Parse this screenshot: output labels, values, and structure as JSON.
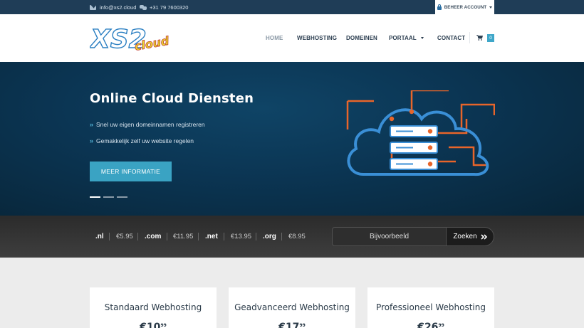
{
  "topbar": {
    "email": "info@xs2.cloud",
    "phone": "+31 79 7600320",
    "account_label": "BEHEER ACCOUNT"
  },
  "header": {
    "logo_text_main": "XS2",
    "logo_text_sub": "cloud",
    "nav": {
      "home": "HOME",
      "webhosting": "WEBHOSTING",
      "domeinen": "DOMEINEN",
      "portaal": "PORTAAL",
      "contact": "CONTACT"
    },
    "cart_count": "0"
  },
  "hero": {
    "title": "Online Cloud Diensten",
    "bullets": [
      "Snel uw eigen domeinnamen registreren",
      "Gemakkelijk zelf uw website regelen"
    ],
    "button_label": "MEER INFORMATIE",
    "slides_total": 3,
    "active_slide": 1
  },
  "domains": {
    "tlds": [
      {
        "name": ".nl",
        "price": "€5.95"
      },
      {
        "name": ".com",
        "price": "€11.95"
      },
      {
        "name": ".net",
        "price": "€13.95"
      },
      {
        "name": ".org",
        "price": "€8.95"
      }
    ],
    "search_placeholder": "Bijvoorbeeld",
    "search_button": "Zoeken"
  },
  "plans": [
    {
      "title": "Standaard Webhosting",
      "price_main": "€10",
      "price_cents": "99"
    },
    {
      "title": "Geadvanceerd Webhosting",
      "price_main": "€17",
      "price_cents": "99"
    },
    {
      "title": "Professioneel Webhosting",
      "price_main": "€26",
      "price_cents": "99"
    }
  ],
  "colors": {
    "topbar": "#1f3d57",
    "accent": "#3aa3c3",
    "illustration_blue": "#3a8fd6",
    "illustration_orange": "#e8652a"
  }
}
